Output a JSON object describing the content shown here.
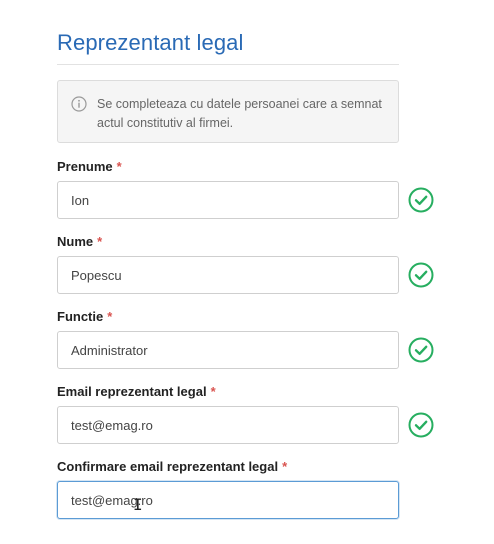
{
  "section": {
    "title": "Reprezentant legal"
  },
  "info": {
    "icon": "info-circle-icon",
    "text": "Se completeaza cu datele persoanei care a semnat actul constitutiv al firmei."
  },
  "required_marker": "*",
  "colors": {
    "title": "#2a6ab5",
    "required": "#d9534f",
    "valid": "#27ae60",
    "focus_border": "#5b9bd5"
  },
  "fields": [
    {
      "label": "Prenume",
      "value": "Ion",
      "valid": true,
      "valid_icon": "check-circle-icon"
    },
    {
      "label": "Nume",
      "value": "Popescu",
      "valid": true,
      "valid_icon": "check-circle-icon"
    },
    {
      "label": "Functie",
      "value": "Administrator",
      "valid": true,
      "valid_icon": "check-circle-icon"
    },
    {
      "label": "Email reprezentant legal",
      "value": "test@emag.ro",
      "valid": true,
      "valid_icon": "check-circle-icon"
    },
    {
      "label": "Confirmare email reprezentant legal",
      "value": "test@emag.ro",
      "valid": false,
      "focused": true
    }
  ]
}
